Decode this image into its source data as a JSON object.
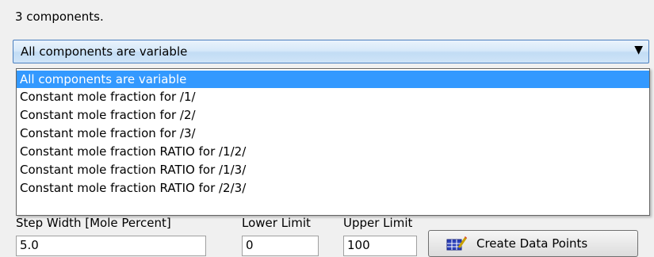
{
  "header": {
    "component_count": "3 components."
  },
  "combo": {
    "selected": "All components are variable",
    "options": [
      "All components are variable",
      "Constant mole fraction for /1/",
      "Constant mole fraction for /2/",
      "Constant mole fraction for /3/",
      "Constant mole fraction RATIO for /1/2/",
      "Constant mole fraction RATIO for /1/3/",
      "Constant mole fraction RATIO for /2/3/"
    ]
  },
  "form": {
    "step_width_label": "Step Width [Mole Percent]",
    "lower_limit_label": "Lower Limit",
    "upper_limit_label": "Upper Limit",
    "step_width_value": "5.0",
    "lower_limit_value": "0",
    "upper_limit_value": "100",
    "create_button_label": "Create Data Points"
  },
  "colors": {
    "selection": "#3399ff",
    "combo_border": "#4a7fbf"
  }
}
